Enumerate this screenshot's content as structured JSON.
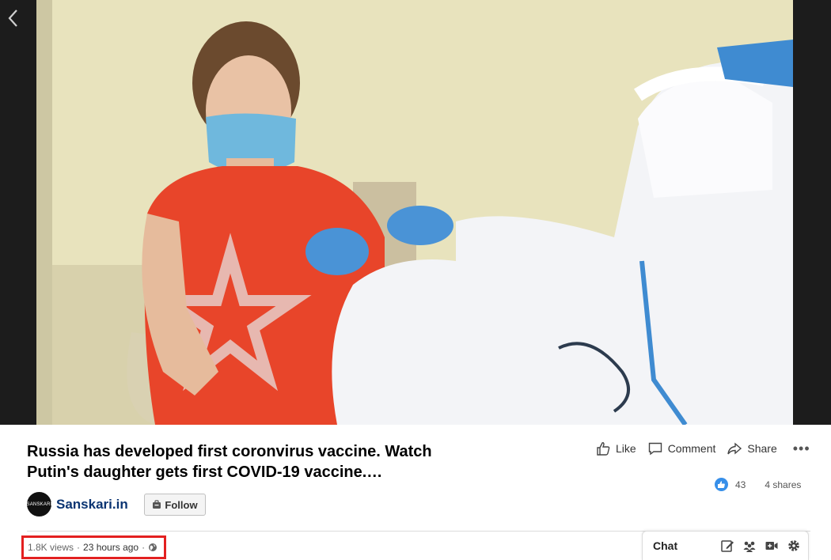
{
  "video": {
    "description": "video frame"
  },
  "post": {
    "title": "Russia has developed first coronvirus vaccine. Watch Putin's daughter gets first COVID-19 vaccine.…"
  },
  "actions": {
    "like": "Like",
    "comment": "Comment",
    "share": "Share",
    "more": "•••"
  },
  "stats": {
    "reactions": "43",
    "shares": "4 shares"
  },
  "author": {
    "avatar_text": "SANSKARI",
    "name": "Sanskari.in",
    "follow_label": "Follow"
  },
  "meta": {
    "views": "1.8K views",
    "separator": "·",
    "time": "23 hours ago",
    "separator2": "·"
  },
  "chat": {
    "label": "Chat"
  },
  "colors": {
    "brand_blue": "#0a3472",
    "like_blue": "#378fe9",
    "highlight_red": "#e32020"
  }
}
